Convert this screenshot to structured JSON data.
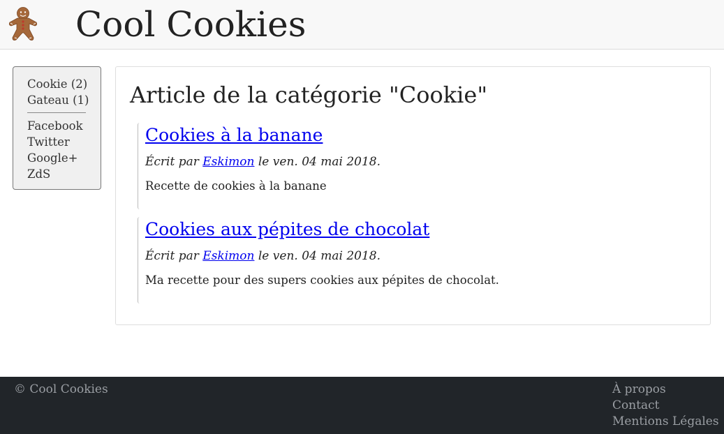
{
  "header": {
    "site_title": "Cool Cookies",
    "logo_icon": "gingerbread-man-icon"
  },
  "sidebar": {
    "categories": [
      {
        "label": "Cookie (2)"
      },
      {
        "label": "Gateau (1)"
      }
    ],
    "social": [
      {
        "label": "Facebook"
      },
      {
        "label": "Twitter"
      },
      {
        "label": "Google+"
      },
      {
        "label": "ZdS"
      }
    ]
  },
  "main": {
    "heading": "Article de la catégorie \"Cookie\"",
    "articles": [
      {
        "title": "Cookies à la banane",
        "meta_prefix": "Écrit par ",
        "author": "Eskimon",
        "meta_suffix": " le ven. 04 mai 2018.",
        "summary": "Recette de cookies à la banane"
      },
      {
        "title": "Cookies aux pépites de chocolat",
        "meta_prefix": "Écrit par ",
        "author": "Eskimon",
        "meta_suffix": " le ven. 04 mai 2018.",
        "summary": "Ma recette pour des supers cookies aux pépites de chocolat."
      }
    ]
  },
  "footer": {
    "copyright": "© Cool Cookies",
    "links": [
      {
        "label": "À propos"
      },
      {
        "label": "Contact"
      },
      {
        "label": "Mentions Légales"
      }
    ]
  },
  "colors": {
    "topbar_bg": "#f8f8f8",
    "footer_bg": "#212529",
    "link": "#0000ee",
    "gingerbread": "#a5683a"
  }
}
